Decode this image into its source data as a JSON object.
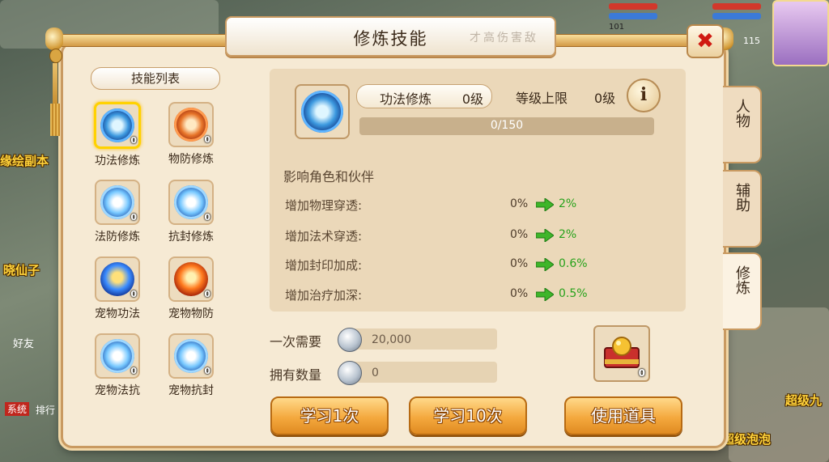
{
  "background": {
    "labels": {
      "left_copy": "缘绘副本",
      "left_npc": "晓仙子",
      "friends": "好友",
      "system": "系统",
      "rank": "排行",
      "right_npc": "超级九",
      "right_npc2": "超级泡泡"
    },
    "levels": [
      "101",
      "115"
    ]
  },
  "window": {
    "title": "修炼技能",
    "title_brush": "才高伤害敌"
  },
  "skill_list": {
    "header": "技能列表",
    "items": [
      {
        "name": "功法修炼",
        "level": "0",
        "icon": "gongfa-skill-icon",
        "color": "blue"
      },
      {
        "name": "物防修炼",
        "level": "0",
        "icon": "wufang-skill-icon",
        "color": "red"
      },
      {
        "name": "法防修炼",
        "level": "0",
        "icon": "fafang-skill-icon",
        "color": "ice"
      },
      {
        "name": "抗封修炼",
        "level": "0",
        "icon": "kangfeng-skill-icon",
        "color": "ice"
      },
      {
        "name": "宠物功法",
        "level": "0",
        "icon": "pet-gongfa-skill-icon",
        "color": "flame"
      },
      {
        "name": "宠物物防",
        "level": "0",
        "icon": "pet-wufang-skill-icon",
        "color": "fire"
      },
      {
        "name": "宠物法抗",
        "level": "0",
        "icon": "pet-fakang-skill-icon",
        "color": "ice"
      },
      {
        "name": "宠物抗封",
        "level": "0",
        "icon": "pet-kangfeng-skill-icon",
        "color": "ice"
      }
    ],
    "selected_index": 0
  },
  "detail": {
    "name": "功法修炼",
    "level": "0级",
    "cap_label": "等级上限",
    "cap_value": "0级",
    "info_icon": "i",
    "progress_text": "0/150",
    "progress_fraction": 0.0,
    "affect_text": "影响角色和伙伴",
    "stats": [
      {
        "label": "增加物理穿透:",
        "from": "0%",
        "to": "2%"
      },
      {
        "label": "增加法术穿透:",
        "from": "0%",
        "to": "2%"
      },
      {
        "label": "增加封印加成:",
        "from": "0%",
        "to": "0.6%"
      },
      {
        "label": "增加治疗加深:",
        "from": "0%",
        "to": "0.5%"
      }
    ]
  },
  "cost": {
    "need_label": "一次需要",
    "need_value": "20,000",
    "own_label": "拥有数量",
    "own_value": "0"
  },
  "item": {
    "count": "0",
    "icon": "treasure-chest-icon"
  },
  "buttons": {
    "learn_once": "学习1次",
    "learn_ten": "学习10次",
    "use_item": "使用道具"
  },
  "tabs": [
    {
      "label": "人物",
      "active": false
    },
    {
      "label": "辅助",
      "active": false
    },
    {
      "label": "修炼",
      "active": true
    }
  ],
  "colors": {
    "accent": "#f4a93e",
    "increase": "#27a21b",
    "close": "#d01a12",
    "selected": "#ffd200"
  }
}
